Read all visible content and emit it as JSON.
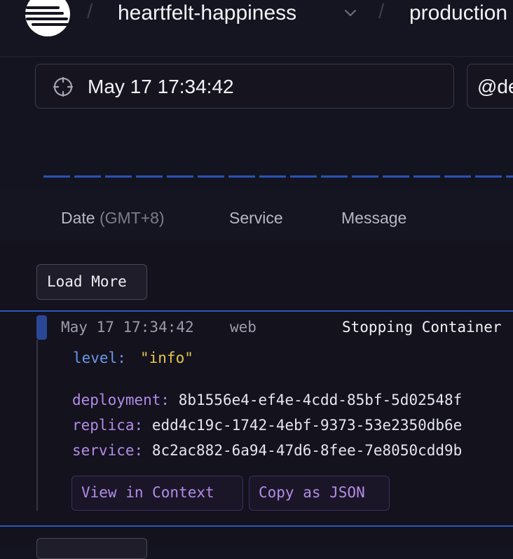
{
  "header": {
    "separator": "/",
    "project_name": "heartfelt-happiness",
    "environment_name": "production"
  },
  "search": {
    "timestamp_value": "May 17 17:34:42",
    "filter_value": "@deployment"
  },
  "columns": {
    "date_label": "Date",
    "date_tz": "(GMT+8)",
    "service_label": "Service",
    "message_label": "Message"
  },
  "logs": {
    "load_more_label": "Load More",
    "entry": {
      "timestamp": "May 17 17:34:42",
      "service": "web",
      "message": "Stopping Container",
      "level_key": "level:",
      "level_value": "\"info\"",
      "attributes": [
        {
          "key": "deployment:",
          "value": "8b1556e4-ef4e-4cdd-85bf-5d02548f"
        },
        {
          "key": "replica:",
          "value": "edd4c19c-1742-4ebf-9373-53e2350db6e"
        },
        {
          "key": "service:",
          "value": "8c2ac882-6a94-47d6-8fee-7e8050cdd9b"
        }
      ],
      "actions": {
        "view_context_label": "View in Context",
        "copy_json_label": "Copy as JSON"
      }
    }
  },
  "colors": {
    "background": "#141320",
    "accent_blue": "#2b56b8",
    "key_purple": "#b38be8",
    "level_yellow": "#e4c84c"
  },
  "icons": {
    "logo": "railway-logo-icon",
    "dropdown": "chevron-down-icon",
    "timestamp": "crosshair-icon"
  }
}
